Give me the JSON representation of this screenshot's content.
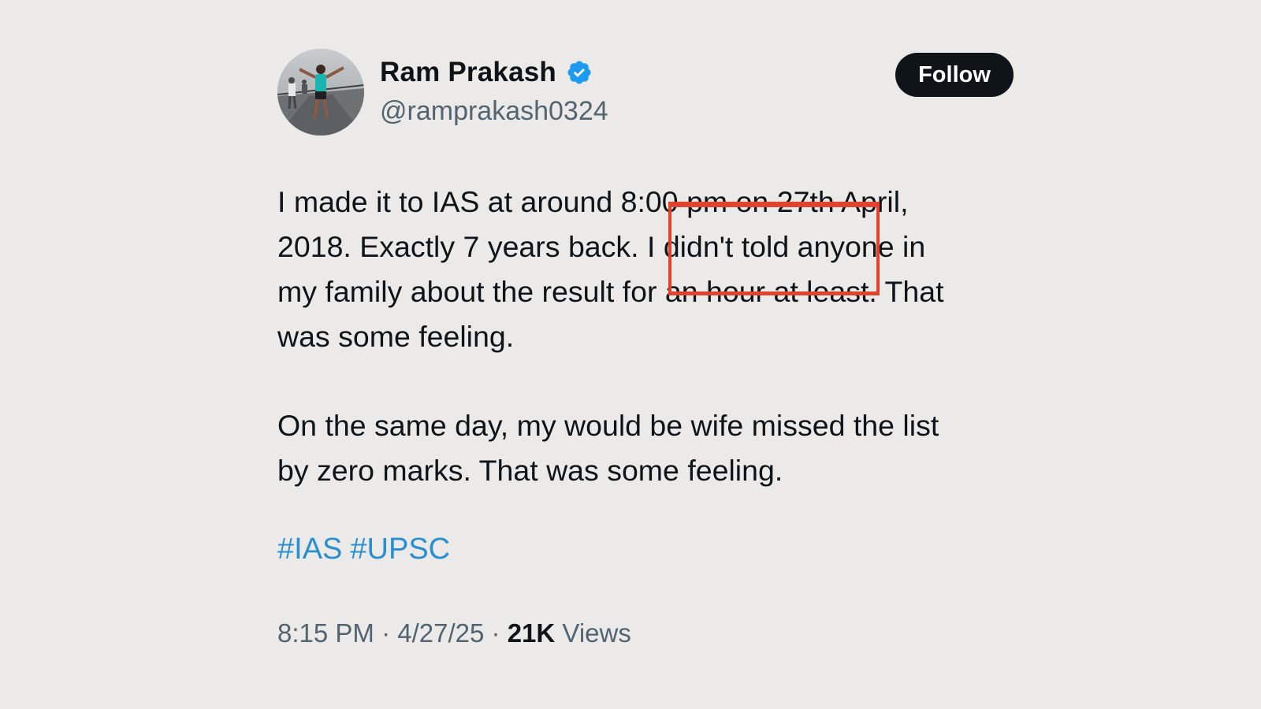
{
  "author": {
    "display_name": "Ram Prakash",
    "handle": "@ramprakash0324",
    "verified": true
  },
  "follow_button": {
    "label": "Follow"
  },
  "tweet": {
    "paragraph1_lines": [
      "I made it to IAS at around 8:00 pm on 27th April,",
      "2018. Exactly 7 years back. I didn't told anyone in",
      "my family about the result for an hour at least. That",
      "was some feeling."
    ],
    "paragraph2_lines": [
      "On the same day, my would be wife missed the list",
      "by zero marks. That was some feeling."
    ],
    "hashtags": [
      "#IAS",
      "#UPSC"
    ]
  },
  "meta": {
    "time": "8:15 PM",
    "separator": "·",
    "date": "4/27/25",
    "views_count": "21K",
    "views_label": "Views"
  },
  "colors": {
    "background": "#ebeae8",
    "text": "#0f1419",
    "secondary": "#536471",
    "hashtag": "#2a8fd1",
    "verified": "#1d9bf0",
    "annotation": "#e0442c"
  },
  "icons": {
    "verified": "verified-badge-icon"
  }
}
